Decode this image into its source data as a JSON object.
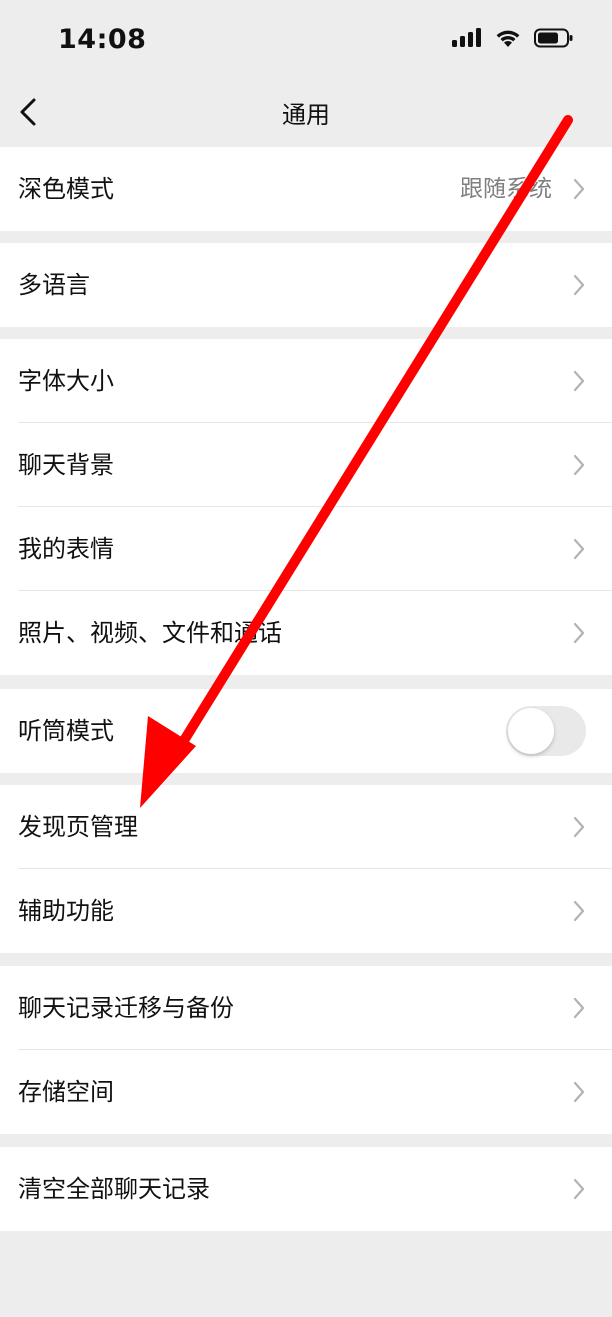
{
  "status_bar": {
    "time": "14:08",
    "icons": [
      "signal-icon",
      "wifi-icon",
      "battery-icon"
    ]
  },
  "nav": {
    "title": "通用",
    "back_icon": "chevron-left-icon"
  },
  "groups": [
    {
      "rows": [
        {
          "label": "深色模式",
          "value": "跟随系统"
        }
      ]
    },
    {
      "rows": [
        {
          "label": "多语言"
        }
      ]
    },
    {
      "rows": [
        {
          "label": "字体大小"
        },
        {
          "label": "聊天背景"
        },
        {
          "label": "我的表情"
        },
        {
          "label": "照片、视频、文件和通话"
        }
      ]
    },
    {
      "rows": [
        {
          "label": "听筒模式",
          "toggle": false
        }
      ]
    },
    {
      "rows": [
        {
          "label": "发现页管理"
        },
        {
          "label": "辅助功能"
        }
      ]
    },
    {
      "rows": [
        {
          "label": "聊天记录迁移与备份"
        },
        {
          "label": "存储空间"
        }
      ]
    },
    {
      "rows": [
        {
          "label": "清空全部聊天记录"
        }
      ]
    }
  ],
  "annotation": {
    "arrow_color": "#ff0000"
  }
}
